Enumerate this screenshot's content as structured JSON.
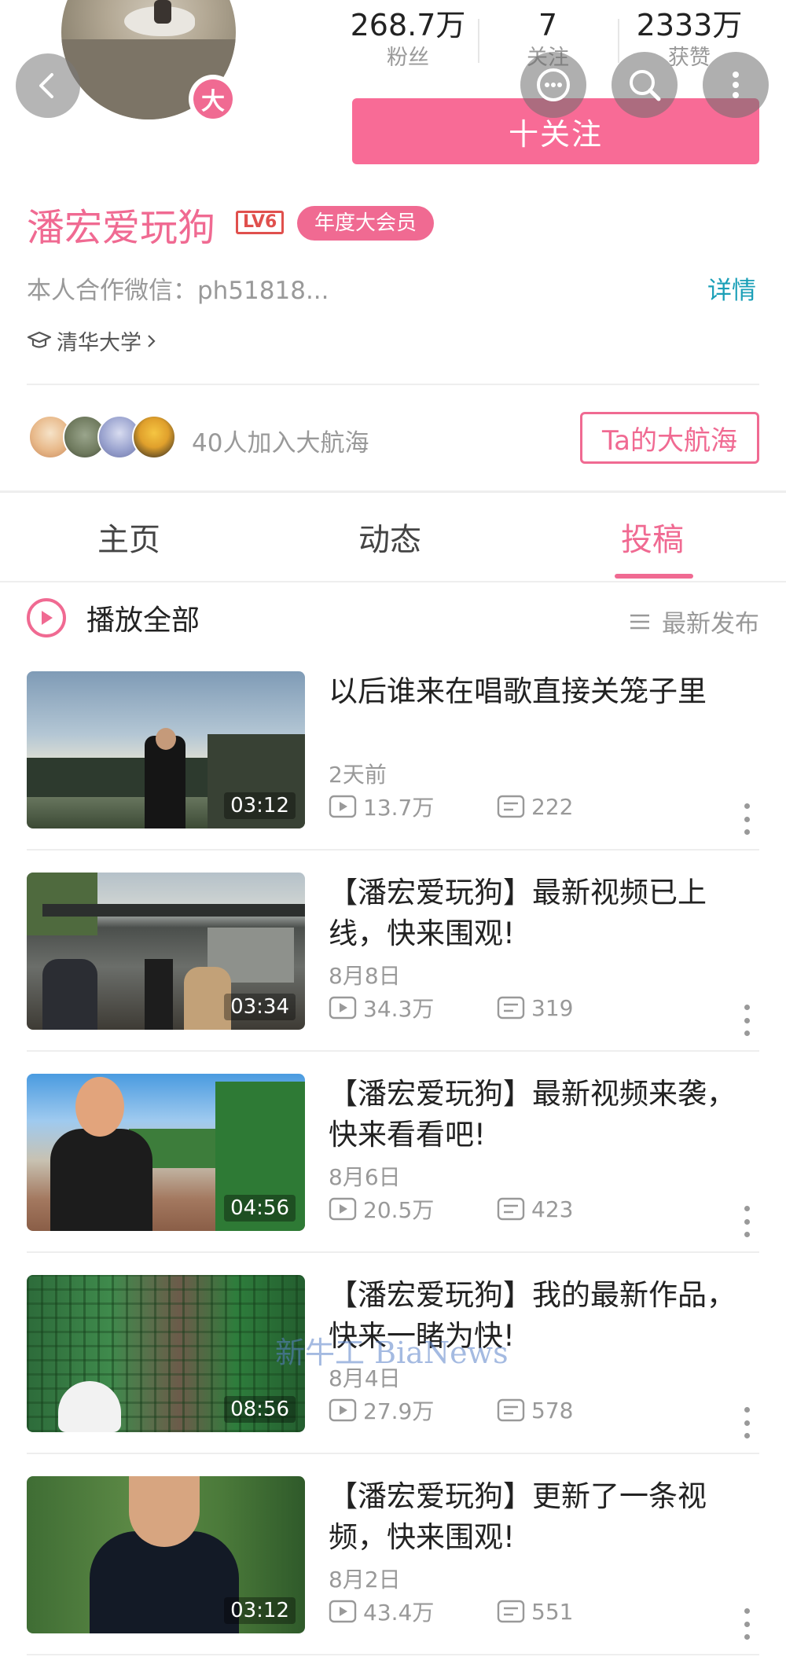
{
  "header": {
    "stats": [
      {
        "value": "268.7万",
        "label": "粉丝"
      },
      {
        "value": "7",
        "label": "关注"
      },
      {
        "value": "2333万",
        "label": "获赞"
      }
    ],
    "avatar_badge": "大",
    "follow_label": "十关注",
    "icons": [
      "back-icon",
      "chat-icon",
      "search-icon",
      "more-icon"
    ]
  },
  "profile": {
    "name": "潘宏爱玩狗",
    "level": "LV6",
    "vip_label": "年度大会员",
    "bio": "本人合作微信：ph51818...",
    "detail_link": "详情",
    "school": "清华大学"
  },
  "fans": {
    "text": "40人加入大航海",
    "button": "Ta的大航海"
  },
  "tabs": [
    {
      "label": "主页",
      "active": false
    },
    {
      "label": "动态",
      "active": false
    },
    {
      "label": "投稿",
      "active": true
    }
  ],
  "list": {
    "play_all": "播放全部",
    "sort_label": "最新发布",
    "videos": [
      {
        "title": "以后谁来在唱歌直接关笼子里",
        "date": "2天前",
        "views": "13.7万",
        "comments": "222",
        "duration": "03:12"
      },
      {
        "title": "【潘宏爱玩狗】最新视频已上线，快来围观!",
        "date": "8月8日",
        "views": "34.3万",
        "comments": "319",
        "duration": "03:34"
      },
      {
        "title": "【潘宏爱玩狗】最新视频来袭，快来看看吧!",
        "date": "8月6日",
        "views": "20.5万",
        "comments": "423",
        "duration": "04:56"
      },
      {
        "title": "【潘宏爱玩狗】我的最新作品，快来一睹为快!",
        "date": "8月4日",
        "views": "27.9万",
        "comments": "578",
        "duration": "08:56"
      },
      {
        "title": "【潘宏爱玩狗】更新了一条视频，快来围观!",
        "date": "8月2日",
        "views": "43.4万",
        "comments": "551",
        "duration": "03:12"
      }
    ]
  },
  "watermark": "新牛工 BiaNews",
  "colors": {
    "accent": "#f06a92",
    "follow_button": "#f86b96",
    "link": "#1a9fb7",
    "muted": "#999999"
  }
}
